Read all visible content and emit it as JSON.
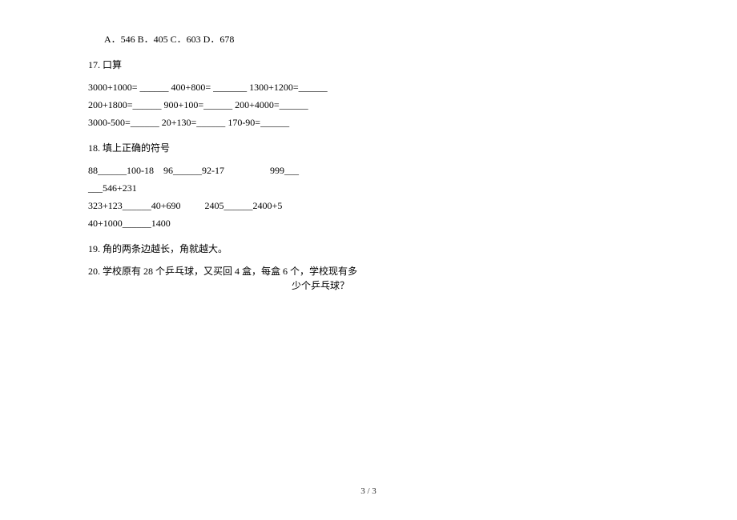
{
  "mc": {
    "text": "A．546  B．405  C．603  D．678"
  },
  "q17": {
    "title": "17. 口算",
    "row1": {
      "a": "3000+1000= ______ ",
      "b": "400+800= _______ ",
      "c": "1300+1200=______"
    },
    "row2": {
      "a": "200+1800=______ ",
      "b": "900+100=______ ",
      "c": "200+4000=______"
    },
    "row3": {
      "a": "3000-500=______ ",
      "b": "20+130=______ ",
      "c": "170-90=______"
    }
  },
  "q18": {
    "title": "18. 填上正确的符号",
    "row1": {
      "a": "88______100-18    ",
      "b": "96______92-17                   ",
      "c": "999___"
    },
    "row2": "___546+231",
    "row3": {
      "a": "323+123______40+690          ",
      "b": "2405______2400+5"
    },
    "row4": "40+1000______1400"
  },
  "q19": {
    "text": "19. 角的两条边越长，角就越大。"
  },
  "q20": {
    "line1": "20. 学校原有 28 个乒乓球，又买回 4 盒，每盒 6 个，学校现有多",
    "line2": "少个乒乓球？"
  },
  "footer": {
    "page": "3 / 3"
  }
}
